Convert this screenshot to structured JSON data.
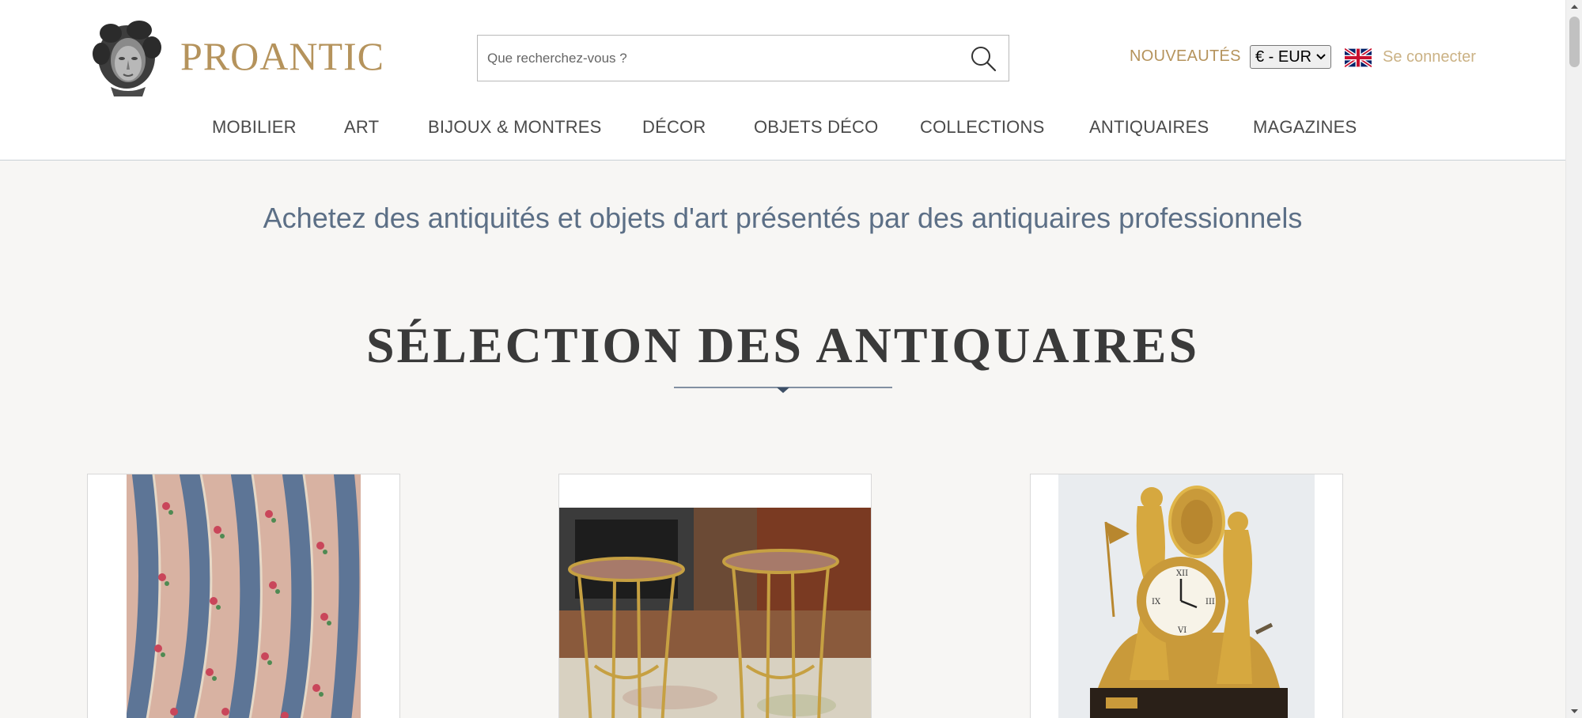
{
  "header": {
    "brand": "PROANTIC",
    "search_placeholder": "Que recherchez-vous ?",
    "nouveautes": "NOUVEAUTÉS",
    "currency": "€ - EUR",
    "login": "Se connecter",
    "brand_color": "#b5935c"
  },
  "nav": {
    "items": [
      "MOBILIER",
      "ART",
      "BIJOUX & MONTRES",
      "DÉCOR",
      "OBJETS DÉCO",
      "COLLECTIONS",
      "ANTIQUAIRES",
      "MAGAZINES"
    ]
  },
  "main": {
    "tagline": "Achetez des antiquités et objets d'art présentés par des antiquaires professionnels",
    "section_title": "SÉLECTION DES ANTIQUAIRES",
    "products": [
      {
        "icon": "striped-fabric-image"
      },
      {
        "icon": "gueridon-tables-image"
      },
      {
        "icon": "gilt-bronze-clock-image"
      }
    ]
  },
  "icons": {
    "search": "search-icon",
    "flag": "uk-flag-icon",
    "logo": "bust-logo-icon"
  }
}
